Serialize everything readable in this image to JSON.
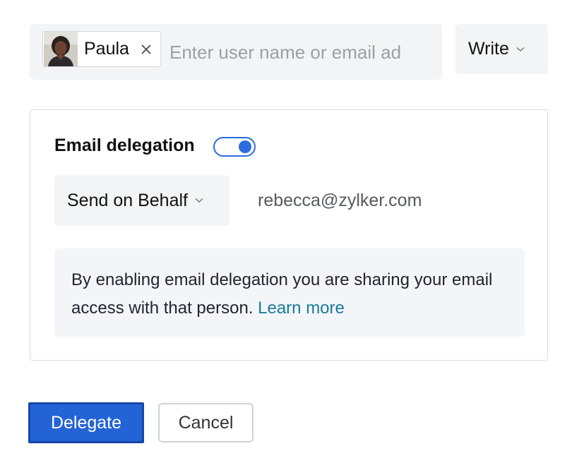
{
  "recipient": {
    "chip_name": "Paula",
    "input_placeholder": "Enter user name or email ad",
    "input_value": ""
  },
  "permission": {
    "selected": "Write"
  },
  "delegation": {
    "title": "Email delegation",
    "enabled": true,
    "send_mode": "Send on Behalf",
    "email": "rebecca@zylker.com",
    "info_text": "By enabling email delegation you are sharing your email access with that person.",
    "learn_more": "Learn more"
  },
  "actions": {
    "delegate_label": "Delegate",
    "cancel_label": "Cancel"
  },
  "colors": {
    "accent": "#2463d6",
    "link": "#1a7b99",
    "field_bg": "#f3f4f6"
  },
  "icons": [
    "avatar-photo",
    "close-icon",
    "chevron-down-icon",
    "toggle-switch"
  ]
}
